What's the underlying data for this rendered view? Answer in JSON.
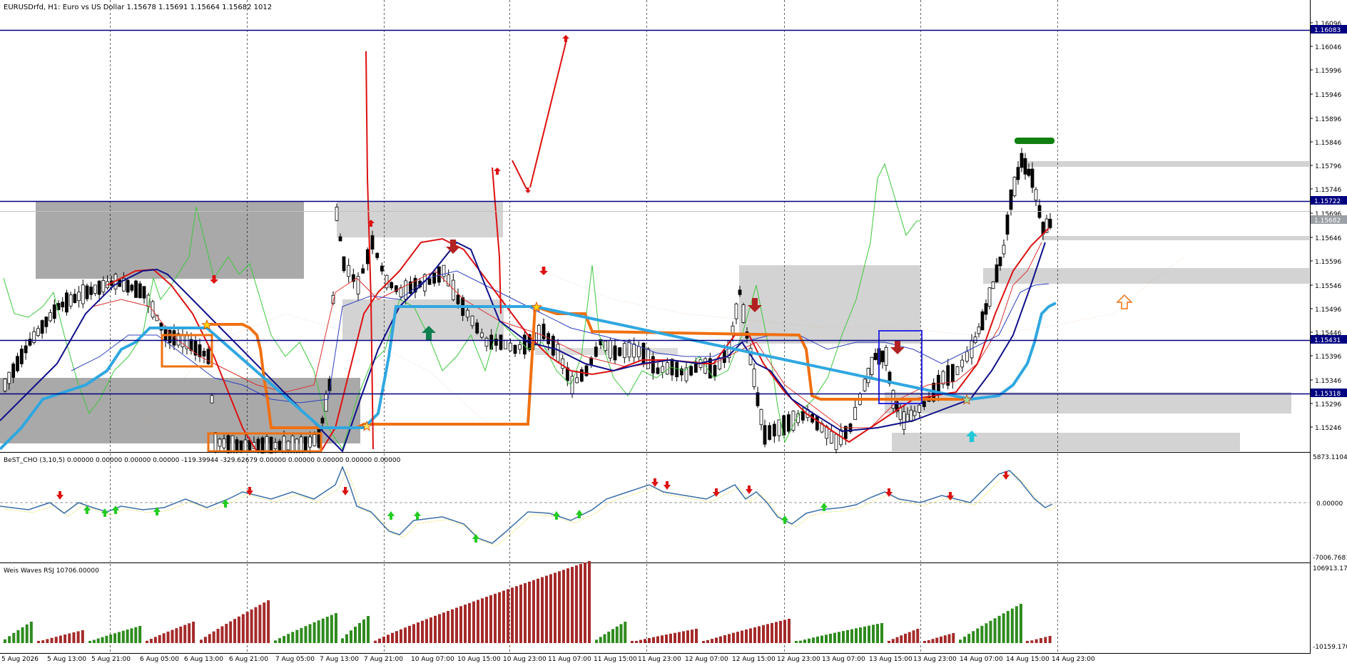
{
  "main_pane": {
    "title": "EURUSDrfd, H1:  Euro vs US Dollar  1.15678 1.15691 1.15664 1.15682  1012",
    "price_axis": [
      "1.16096",
      "1.16046",
      "1.15996",
      "1.15946",
      "1.15896",
      "1.15846",
      "1.15796",
      "1.15746",
      "1.15696",
      "1.15646",
      "1.15596",
      "1.15546",
      "1.15496",
      "1.15446",
      "1.15396",
      "1.15346",
      "1.15296",
      "1.15246"
    ],
    "highlighted_levels": [
      {
        "label": "1.16083",
        "color": "#000080"
      },
      {
        "label": "1.15722",
        "color": "#000080"
      },
      {
        "label": "1.15682",
        "color": "#9aa0a6"
      },
      {
        "label": "1.15431",
        "color": "#000080"
      },
      {
        "label": "1.15318",
        "color": "#000080"
      }
    ]
  },
  "oscillator_pane": {
    "title": "BeST_CHO (3,10,5)    0.00000 0.00000 0.00000 0.00000 -119.39944 -329.62679 0.00000 0.00000 0.00000 0.00000 0.00000",
    "axis_top": "5873.11045",
    "axis_zero": "0.00000",
    "axis_bottom": "-7006.76810"
  },
  "volume_pane": {
    "title": "Weis Waves RSJ  10706.00000",
    "axis_top": "106913.1700",
    "axis_bottom": "-10159.1700"
  },
  "time_axis": [
    "5 Aug 2026",
    "5 Aug 13:00",
    "5 Aug 21:00",
    "6 Aug 05:00",
    "6 Aug 13:00",
    "6 Aug 21:00",
    "7 Aug 05:00",
    "7 Aug 13:00",
    "7 Aug 21:00",
    "10 Aug 07:00",
    "10 Aug 15:00",
    "10 Aug 23:00",
    "11 Aug 07:00",
    "11 Aug 15:00",
    "11 Aug 23:00",
    "12 Aug 07:00",
    "12 Aug 15:00",
    "12 Aug 23:00",
    "13 Aug 07:00",
    "13 Aug 15:00",
    "13 Aug 23:00",
    "14 Aug 07:00",
    "14 Aug 15:00",
    "14 Aug 23:00"
  ],
  "colors": {
    "level_line": "#000080",
    "bull_bar": "#2e8b1e",
    "bear_bar": "#a52a2a",
    "oscillator": "#3a6ea5",
    "signal": "#e8e060",
    "baseline_blue": "#2fa7e0",
    "baseline_orange": "#f07010",
    "ma_red": "#dd1111",
    "ma_navy": "#10108a",
    "zone_grey": "#c8c8c8"
  }
}
